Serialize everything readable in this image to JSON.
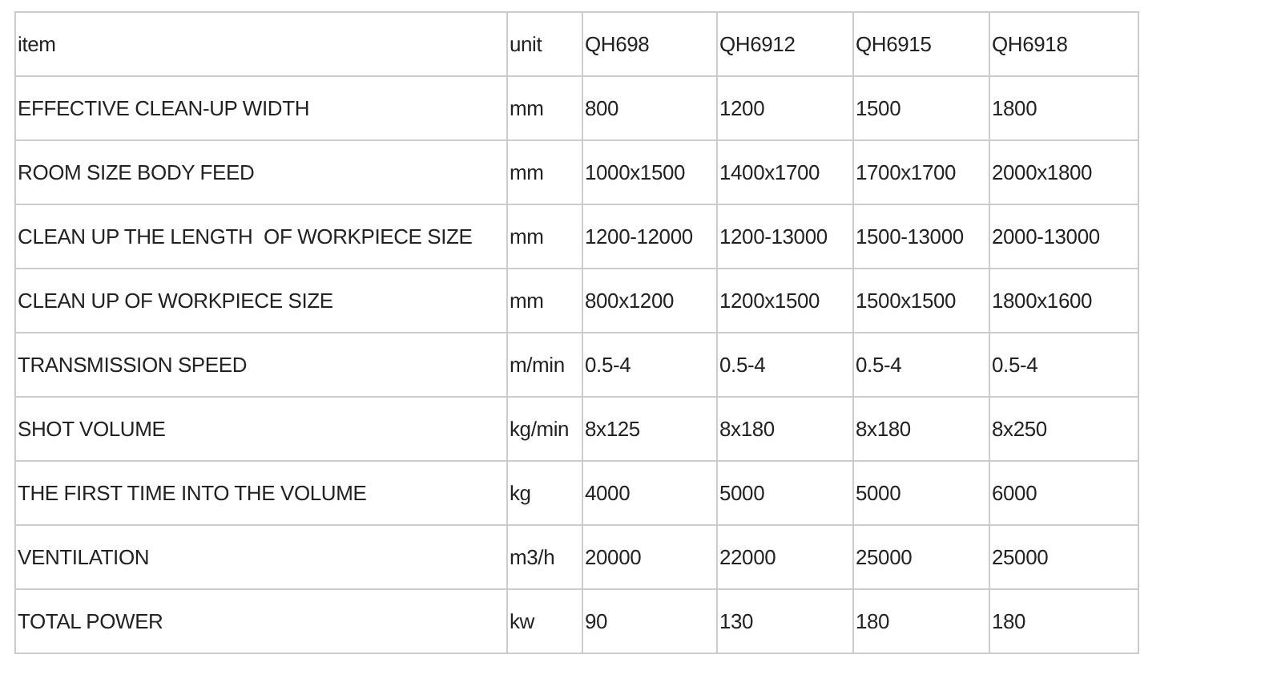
{
  "table": {
    "columns": [
      "item",
      "unit",
      "QH698",
      "QH6912",
      "QH6915",
      "QH6918"
    ],
    "rows": [
      [
        "EFFECTIVE CLEAN-UP WIDTH",
        "mm",
        "800",
        "1200",
        "1500",
        "1800"
      ],
      [
        "ROOM SIZE BODY FEED",
        "mm",
        "1000x1500",
        "1400x1700",
        "1700x1700",
        "2000x1800"
      ],
      [
        "CLEAN UP THE LENGTH  OF WORKPIECE SIZE",
        "mm",
        "1200-12000",
        "1200-13000",
        "1500-13000",
        "2000-13000"
      ],
      [
        "CLEAN UP OF WORKPIECE SIZE",
        "mm",
        "800x1200",
        "1200x1500",
        "1500x1500",
        "1800x1600"
      ],
      [
        "TRANSMISSION SPEED",
        "m/min",
        "0.5-4",
        "0.5-4",
        "0.5-4",
        "0.5-4"
      ],
      [
        "SHOT VOLUME",
        "kg/min",
        "8x125",
        "8x180",
        "8x180",
        "8x250"
      ],
      [
        "THE FIRST TIME INTO THE VOLUME",
        "kg",
        "4000",
        "5000",
        "5000",
        "6000"
      ],
      [
        "VENTILATION",
        "m3/h",
        "20000",
        "22000",
        "25000",
        "25000"
      ],
      [
        "TOTAL POWER",
        "kw",
        "90",
        "130",
        "180",
        "180"
      ]
    ]
  }
}
